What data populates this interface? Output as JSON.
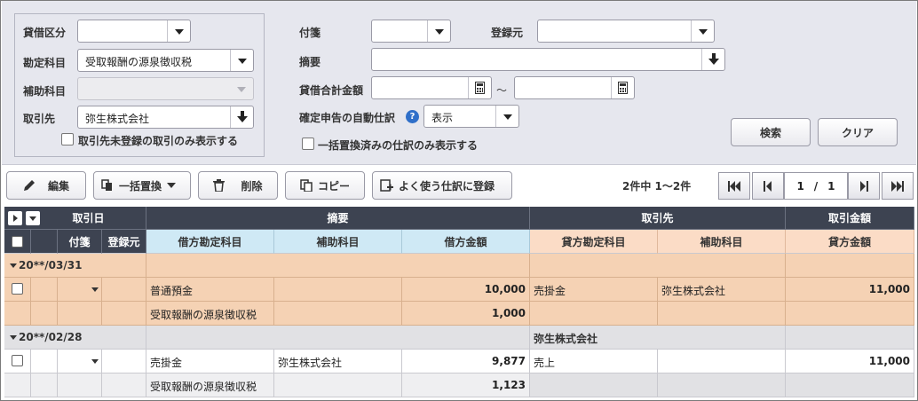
{
  "filter": {
    "taishaku_kubun_label": "貸借区分",
    "taishaku_kubun_value": "",
    "kanjou_kamoku_label": "勘定科目",
    "kanjou_kamoku_value": "受取報酬の源泉徴収税",
    "hojo_kamoku_label": "補助科目",
    "hojo_kamoku_value": "",
    "torihikisaki_label": "取引先",
    "torihikisaki_value": "弥生株式会社",
    "unregistered_only_label": "取引先未登録の取引のみ表示する",
    "fusen_label": "付箋",
    "fusen_value": "",
    "touroku_moto_label": "登録元",
    "touroku_moto_value": "",
    "tekiyou_label": "摘要",
    "tekiyou_value": "",
    "goukei_label": "貸借合計金額",
    "goukei_from": "",
    "goukei_sep": "～",
    "goukei_to": "",
    "auto_shiwake_label": "確定申告の自動仕訳",
    "help_glyph": "?",
    "auto_shiwake_value": "表示",
    "bulk_replaced_only_label": "一括置換済みの仕訳のみ表示する",
    "search_button": "検索",
    "clear_button": "クリア"
  },
  "toolbar": {
    "edit": "編集",
    "bulk_replace": "一括置換",
    "delete": "削除",
    "copy": "コピー",
    "register_frequent": "よく使う仕訳に登録"
  },
  "pager": {
    "summary": "2件中 1～2件",
    "current": "1",
    "slash": "/",
    "total": "1"
  },
  "grid": {
    "headers_top": {
      "date": "取引日",
      "tekiyou": "摘要",
      "torihikisaki": "取引先",
      "amount": "取引金額"
    },
    "headers_sub": {
      "fusen": "付箋",
      "touroku": "登録元",
      "debit_account": "借方勘定科目",
      "debit_sub": "補助科目",
      "debit_amount": "借方金額",
      "credit_account": "貸方勘定科目",
      "credit_sub": "補助科目",
      "credit_amount": "貸方金額"
    },
    "groups": [
      {
        "date": "20**/03/31",
        "tekiyou": "",
        "torihikisaki": "",
        "rows": [
          {
            "debit_account": "普通預金",
            "debit_sub": "",
            "debit_amount": "10,000",
            "credit_account": "売掛金",
            "credit_sub": "弥生株式会社",
            "credit_amount": "11,000"
          },
          {
            "debit_account": "受取報酬の源泉徴収税",
            "debit_sub": "",
            "debit_amount": "1,000",
            "credit_account": "",
            "credit_sub": "",
            "credit_amount": ""
          }
        ]
      },
      {
        "date": "20**/02/28",
        "tekiyou": "",
        "torihikisaki": "弥生株式会社",
        "rows": [
          {
            "debit_account": "売掛金",
            "debit_sub": "弥生株式会社",
            "debit_amount": "9,877",
            "credit_account": "売上",
            "credit_sub": "",
            "credit_amount": "11,000"
          },
          {
            "debit_account": "受取報酬の源泉徴収税",
            "debit_sub": "",
            "debit_amount": "1,123",
            "credit_account": "",
            "credit_sub": "",
            "credit_amount": ""
          }
        ]
      }
    ]
  },
  "colors": {
    "header_dark": "#3d4351",
    "debit_header": "#cfe9f5",
    "credit_header": "#fbdcc6",
    "selected_row": "#f5d2b4",
    "help_icon": "#2f6fc9"
  }
}
